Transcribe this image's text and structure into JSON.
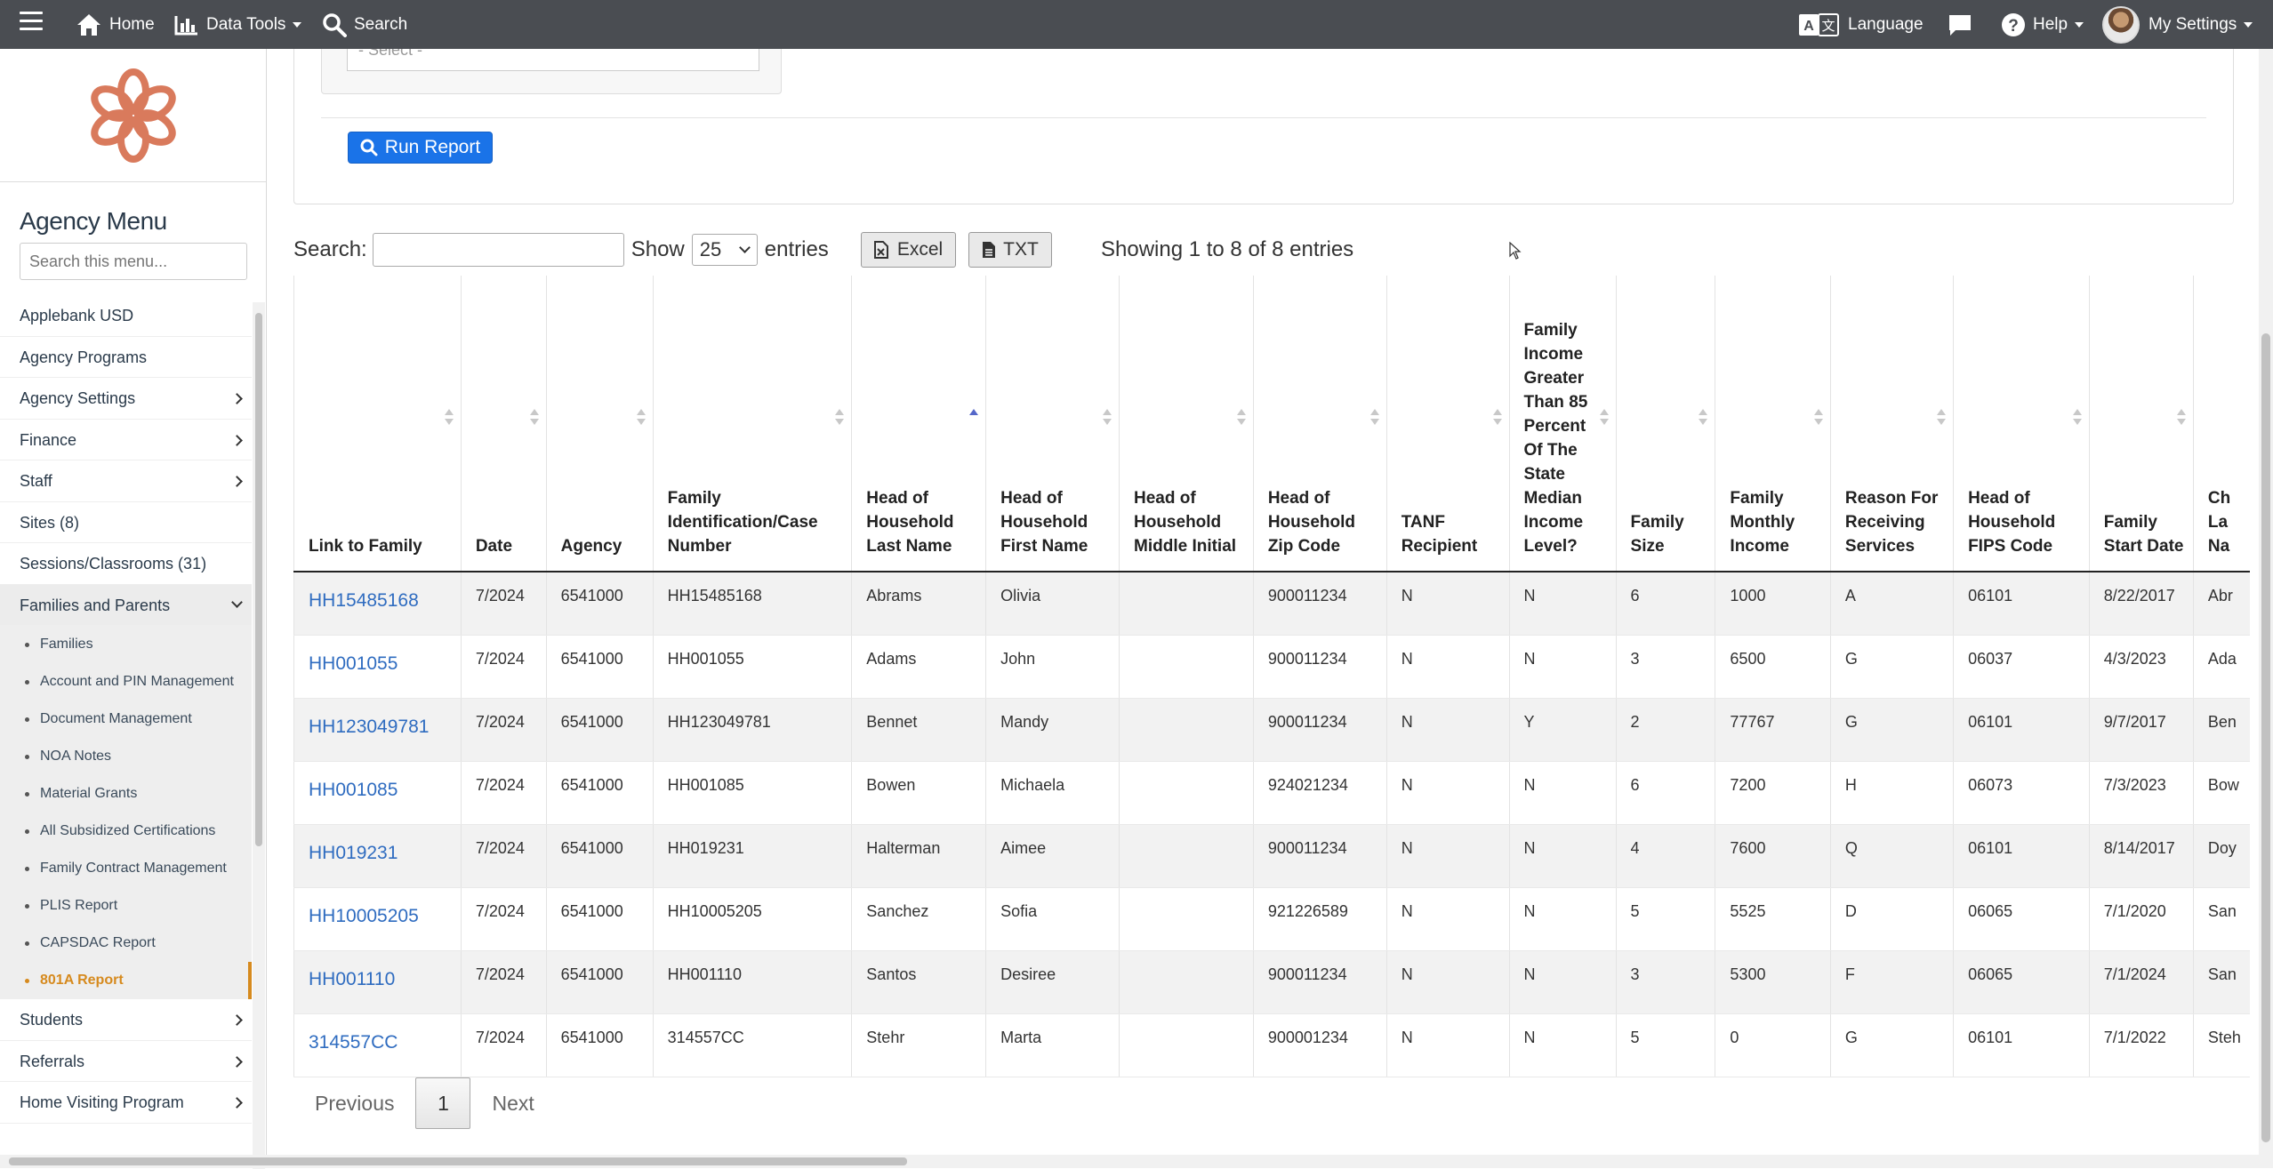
{
  "nav": {
    "home": "Home",
    "data_tools": "Data Tools",
    "search": "Search",
    "language": "Language",
    "help": "Help",
    "settings": "My Settings"
  },
  "sidebar": {
    "title": "Agency Menu",
    "search_placeholder": "Search this menu...",
    "items": [
      {
        "label": "Applebank USD",
        "chevron": false
      },
      {
        "label": "Agency Programs",
        "chevron": false
      },
      {
        "label": "Agency Settings",
        "chevron": true
      },
      {
        "label": "Finance",
        "chevron": true
      },
      {
        "label": "Staff",
        "chevron": true
      },
      {
        "label": "Sites (8)",
        "chevron": false
      },
      {
        "label": "Sessions/Classrooms (31)",
        "chevron": false
      },
      {
        "label": "Families and Parents",
        "chevron": true,
        "expanded": true
      }
    ],
    "subitems": [
      "Families",
      "Account and PIN Management",
      "Document Management",
      "NOA Notes",
      "Material Grants",
      "All Subsidized Certifications",
      "Family Contract Management",
      "PLIS Report",
      "CAPSDAC Report",
      "801A Report"
    ],
    "active_subitem": "801A Report",
    "items_after": [
      {
        "label": "Students",
        "chevron": true
      },
      {
        "label": "Referrals",
        "chevron": true
      },
      {
        "label": "Home Visiting Program",
        "chevron": true
      }
    ]
  },
  "filter": {
    "select_placeholder": "- Select -",
    "run_report": "Run Report"
  },
  "controls": {
    "search_label": "Search:",
    "show_label": "Show",
    "entries_value": "25",
    "entries_label": "entries",
    "excel": "Excel",
    "txt": "TXT",
    "info": "Showing 1 to 8 of 8 entries"
  },
  "table": {
    "columns": [
      "Link to Family",
      "Date",
      "Agency",
      "Family Identification/Case Number",
      "Head of Household Last Name",
      "Head of Household First Name",
      "Head of Household Middle Initial",
      "Head of Household Zip Code",
      "TANF Recipient",
      "Family Income Greater Than 85 Percent Of The State Median Income Level?",
      "Family Size",
      "Family Monthly Income",
      "Reason For Receiving Services",
      "Head of Household FIPS Code",
      "Family Start Date",
      "Ch La Na"
    ],
    "rows": [
      [
        "HH15485168",
        "7/2024",
        "6541000",
        "HH15485168",
        "Abrams",
        "Olivia",
        "",
        "900011234",
        "N",
        "N",
        "6",
        "1000",
        "A",
        "06101",
        "8/22/2017",
        "Abr"
      ],
      [
        "HH001055",
        "7/2024",
        "6541000",
        "HH001055",
        "Adams",
        "John",
        "",
        "900011234",
        "N",
        "N",
        "3",
        "6500",
        "G",
        "06037",
        "4/3/2023",
        "Ada"
      ],
      [
        "HH123049781",
        "7/2024",
        "6541000",
        "HH123049781",
        "Bennet",
        "Mandy",
        "",
        "900011234",
        "N",
        "Y",
        "2",
        "77767",
        "G",
        "06101",
        "9/7/2017",
        "Ben"
      ],
      [
        "HH001085",
        "7/2024",
        "6541000",
        "HH001085",
        "Bowen",
        "Michaela",
        "",
        "924021234",
        "N",
        "N",
        "6",
        "7200",
        "H",
        "06073",
        "7/3/2023",
        "Bow"
      ],
      [
        "HH019231",
        "7/2024",
        "6541000",
        "HH019231",
        "Halterman",
        "Aimee",
        "",
        "900011234",
        "N",
        "N",
        "4",
        "7600",
        "Q",
        "06101",
        "8/14/2017",
        "Doy"
      ],
      [
        "HH10005205",
        "7/2024",
        "6541000",
        "HH10005205",
        "Sanchez",
        "Sofia",
        "",
        "921226589",
        "N",
        "N",
        "5",
        "5525",
        "D",
        "06065",
        "7/1/2020",
        "San"
      ],
      [
        "HH001110",
        "7/2024",
        "6541000",
        "HH001110",
        "Santos",
        "Desiree",
        "",
        "900011234",
        "N",
        "N",
        "3",
        "5300",
        "F",
        "06065",
        "7/1/2024",
        "San"
      ],
      [
        "314557CC",
        "7/2024",
        "6541000",
        "314557CC",
        "Stehr",
        "Marta",
        "",
        "900001234",
        "N",
        "N",
        "5",
        "0",
        "G",
        "06101",
        "7/1/2022",
        "Steh"
      ]
    ]
  },
  "pager": {
    "previous": "Previous",
    "page": "1",
    "next": "Next"
  },
  "colors": {
    "navbar": "#4a4d52",
    "accent": "#1a73e8",
    "link": "#2f6cc0",
    "active_menu": "#d68a1e",
    "logo": "#d97a5c"
  }
}
